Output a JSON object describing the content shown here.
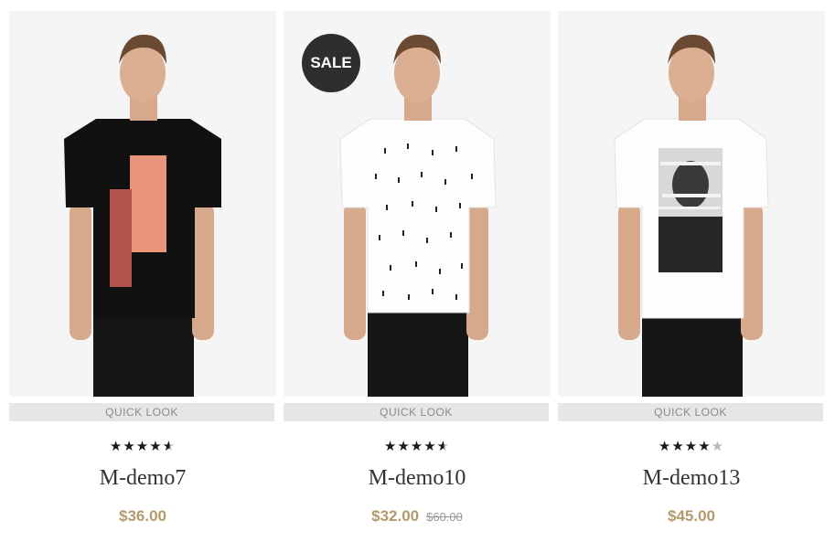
{
  "products": [
    {
      "name": "M-demo7",
      "price": "$36.00",
      "quick_look": "QUICK LOOK",
      "rating": 4.5
    },
    {
      "name": "M-demo10",
      "price": "$32.00",
      "old_price": "$60.00",
      "quick_look": "QUICK LOOK",
      "rating": 4.5,
      "badge": "SALE"
    },
    {
      "name": "M-demo13",
      "price": "$45.00",
      "quick_look": "QUICK LOOK",
      "rating": 4
    }
  ],
  "colors": {
    "accent": "#b39a6d",
    "badge": "#2e2e2e",
    "quick_look_bg": "#e6e6e6"
  },
  "icons": [
    "star-icon",
    "sale-badge"
  ]
}
